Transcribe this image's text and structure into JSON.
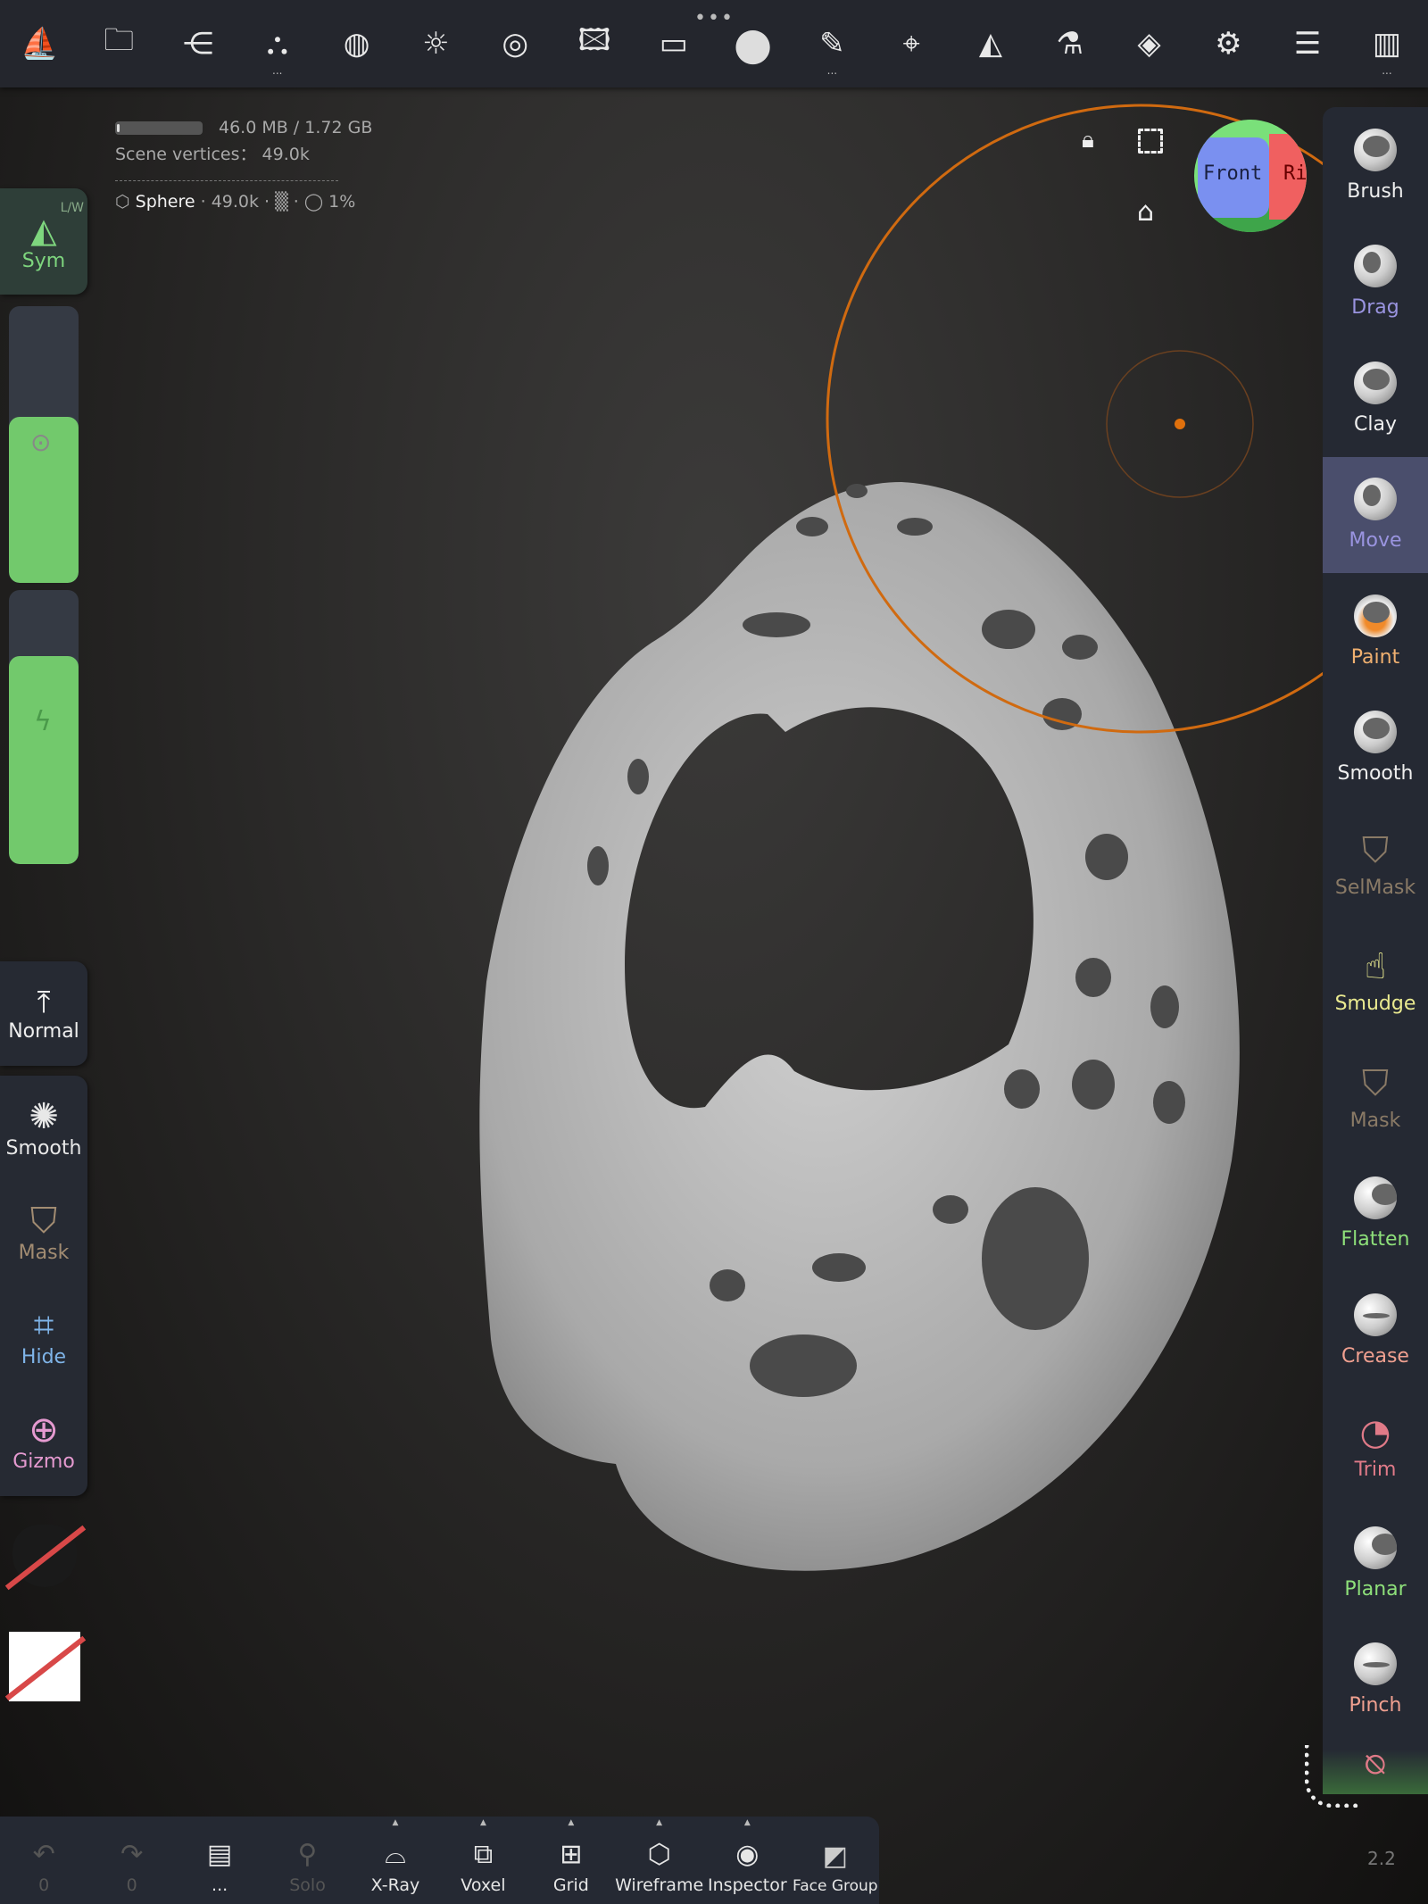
{
  "topbar": {
    "icons": [
      "logo-icon",
      "folder-icon",
      "share-icon",
      "scene-icon",
      "topology-icon",
      "light-icon",
      "camera-lens-icon",
      "image-icon",
      "video-icon",
      "material-icon",
      "pen-icon",
      "picker-icon",
      "symmetry-icon",
      "flask-icon",
      "layers-icon",
      "settings-icon",
      "sliders-icon",
      "store-icon"
    ],
    "handle": "•••",
    "dots": "..."
  },
  "info": {
    "memory": "46.0 MB / 1.72 GB",
    "memory_fraction": 0.027,
    "vertices": "Scene vertices： 49.0k",
    "object_name": "Sphere",
    "object_stats": "· 49.0k · ▒ · ◯ 1%"
  },
  "left": {
    "sym_label": "Sym",
    "sym_mode": "L/W",
    "slider_radius": 0.6,
    "slider_intensity": 0.76,
    "normal": "Normal",
    "tools": [
      {
        "label": "Smooth",
        "color": "#e8e8e8"
      },
      {
        "label": "Mask",
        "color": "#a28c72"
      },
      {
        "label": "Hide",
        "color": "#7fb4e8"
      },
      {
        "label": "Gizmo",
        "color": "#e59ad0"
      }
    ]
  },
  "gyro": {
    "front": "Front",
    "right": "Rig"
  },
  "right_tools": [
    {
      "label": "Brush",
      "color": "#eeeeee"
    },
    {
      "label": "Drag",
      "color": "#9a94e0"
    },
    {
      "label": "Clay",
      "color": "#eeeeee"
    },
    {
      "label": "Move",
      "color": "#9a94e0",
      "selected": true
    },
    {
      "label": "Paint",
      "color": "#f0b070"
    },
    {
      "label": "Smooth",
      "color": "#eeeeee"
    },
    {
      "label": "SelMask",
      "color": "#8a7a66"
    },
    {
      "label": "Smudge",
      "color": "#eaea90"
    },
    {
      "label": "Mask",
      "color": "#8a7a66"
    },
    {
      "label": "Flatten",
      "color": "#8ee07a"
    },
    {
      "label": "Crease",
      "color": "#f0a090"
    },
    {
      "label": "Trim",
      "color": "#e07a88"
    },
    {
      "label": "Planar",
      "color": "#8ee07a"
    },
    {
      "label": "Pinch",
      "color": "#f0a090"
    }
  ],
  "bottom": {
    "undo": "0",
    "redo": "0",
    "more": "...",
    "solo": "Solo",
    "xray": "X-Ray",
    "voxel": "Voxel",
    "grid": "Grid",
    "wireframe": "Wireframe",
    "inspector": "Inspector",
    "facegroup": "Face Group"
  },
  "version": "2.2"
}
